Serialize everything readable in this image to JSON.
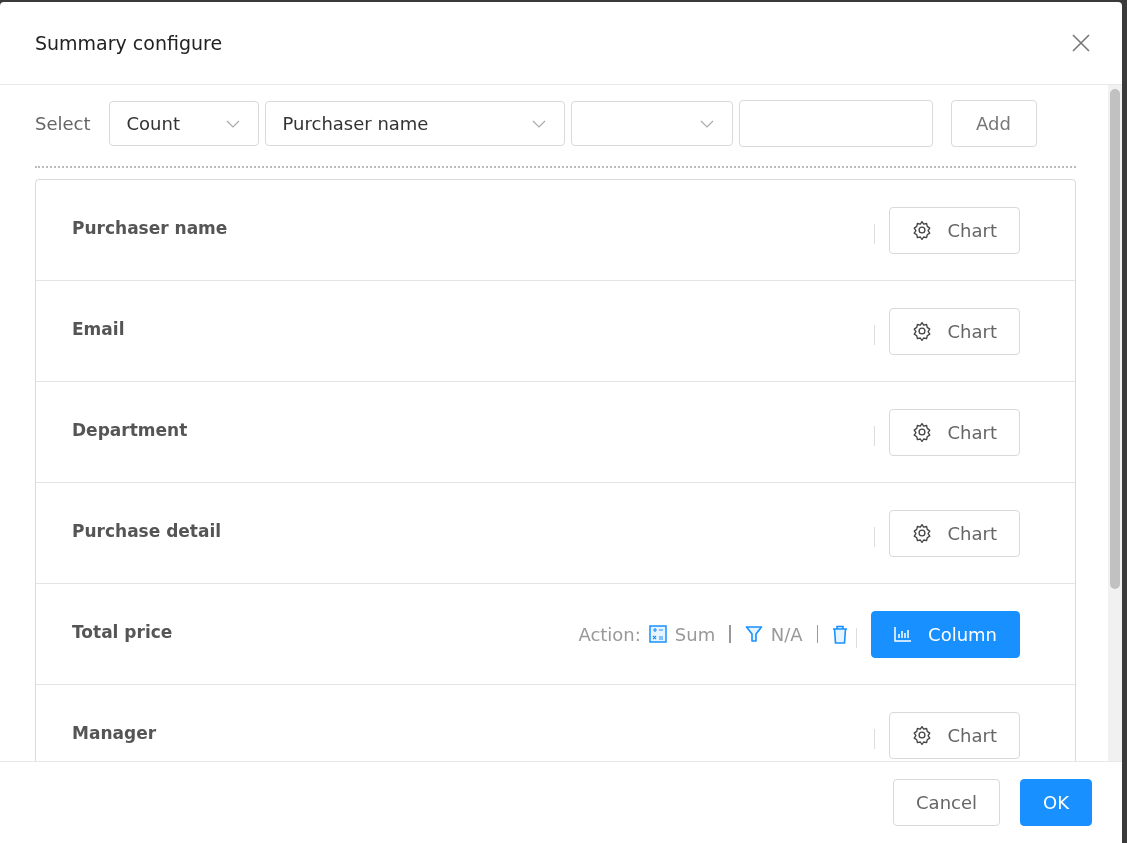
{
  "dialog": {
    "title": "Summary configure"
  },
  "toolbar": {
    "label": "Select",
    "selects": [
      {
        "value": "Count"
      },
      {
        "value": "Purchaser name"
      }
    ],
    "add_button": "Add"
  },
  "fields": [
    {
      "name": "Purchaser name",
      "kind": "chart",
      "button": "Chart"
    },
    {
      "name": "Email",
      "kind": "chart",
      "button": "Chart"
    },
    {
      "name": "Department",
      "kind": "chart",
      "button": "Chart"
    },
    {
      "name": "Purchase detail",
      "kind": "chart",
      "button": "Chart"
    },
    {
      "name": "Total price",
      "kind": "action",
      "action_label": "Action:",
      "aggregate": "Sum",
      "filter": "N/A",
      "button": "Column"
    },
    {
      "name": "Manager",
      "kind": "chart",
      "button": "Chart"
    }
  ],
  "footer": {
    "cancel": "Cancel",
    "ok": "OK"
  }
}
